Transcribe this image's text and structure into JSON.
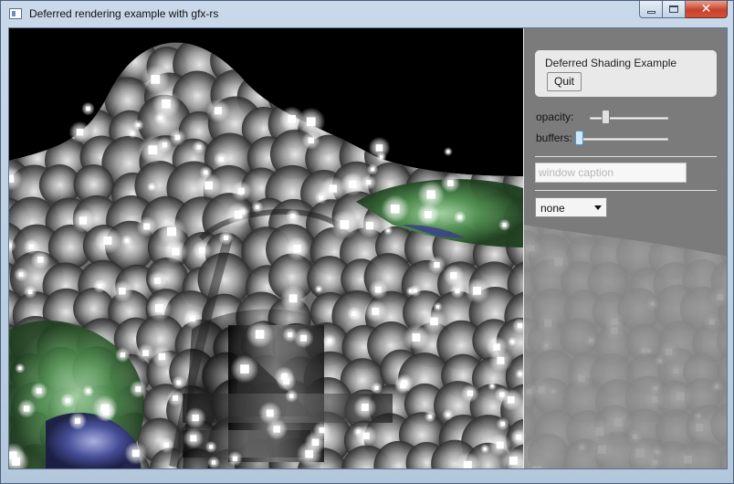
{
  "window": {
    "title": "Deferred rendering example with gfx-rs",
    "controls": {
      "minimize_icon": "minimize-icon",
      "maximize_icon": "maximize-icon",
      "close_icon": "close-icon",
      "close_glyph": "✕"
    }
  },
  "panel": {
    "group_title": "Deferred Shading Example",
    "quit_label": "Quit",
    "opacity_label": "opacity:",
    "opacity_value": 0.2,
    "buffers_label": "buffers:",
    "buffers_value": 0.0,
    "caption_placeholder": "window caption",
    "caption_value": "",
    "combo_value": "none"
  },
  "colors": {
    "window_frame": "#b9cde1",
    "close_red": "#c8412b",
    "panel_bg": "#969696",
    "group_bg": "#e9e9e9",
    "terrain_green": "#3f7f3f",
    "terrain_blue": "#3a3f8c",
    "slider_highlight": "#4e9bc9"
  }
}
